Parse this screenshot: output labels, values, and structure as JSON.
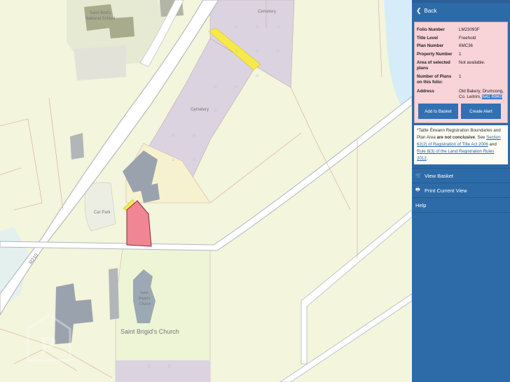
{
  "map": {
    "labels": {
      "school_line1": "Saint Brid's",
      "school_line2": "National School",
      "cemetery_top": "Cemetery",
      "cemetery_mid": "Cemetery",
      "car_park": "Car Park",
      "road": "R210",
      "church_small_1": "Saint",
      "church_small_2": "Brigid's",
      "church_small_3": "Church",
      "church": "Saint Brigid's Church",
      "watermark": "P"
    },
    "colors": {
      "background": "#f3f5dc",
      "cemetery": "#dcd3e1",
      "parcel_selected": "#f08593",
      "parcel_yellow": "#f7e94a",
      "water": "#d6ecf8",
      "building": "#9aa3ad",
      "road_casing": "#b6bac0"
    }
  },
  "panel": {
    "back_label": "Back",
    "folio": [
      {
        "key": "Folio Number",
        "value": "LM23093F"
      },
      {
        "key": "Title Level",
        "value": "Freehold"
      },
      {
        "key": "Plan Number",
        "value": "6MC36"
      },
      {
        "key": "Property Number",
        "value": "1"
      },
      {
        "key": "Area of selected plans",
        "value": "Not available."
      },
      {
        "key": "Number of Plans on this folio:",
        "value": "1"
      },
      {
        "key": "Address",
        "value": "Old Bakery, Drumcong, Co. Leitrim,",
        "value_highlight": "N41 R9K0"
      }
    ],
    "add_to_basket_label": "Add to Basket",
    "create_alert_label": "Create Alert",
    "note": {
      "part1": "*Tailte Éireann Registration Boundaries and Plan Area ",
      "bold": "are not conclusive",
      "part2": ". See ",
      "link1": "Section 62(2) of Registration of Title Act 2006",
      "part3": " and ",
      "link2": "Rule 8(3) of the Land Registration Rules 2012",
      "part4": "."
    },
    "view_basket_label": "View Basket",
    "print_label": "Print Current View",
    "help_label": "Help",
    "colors": {
      "panel": "#2d6aa8",
      "info_box": "#f8d3d8",
      "button": "#3170b4"
    }
  }
}
